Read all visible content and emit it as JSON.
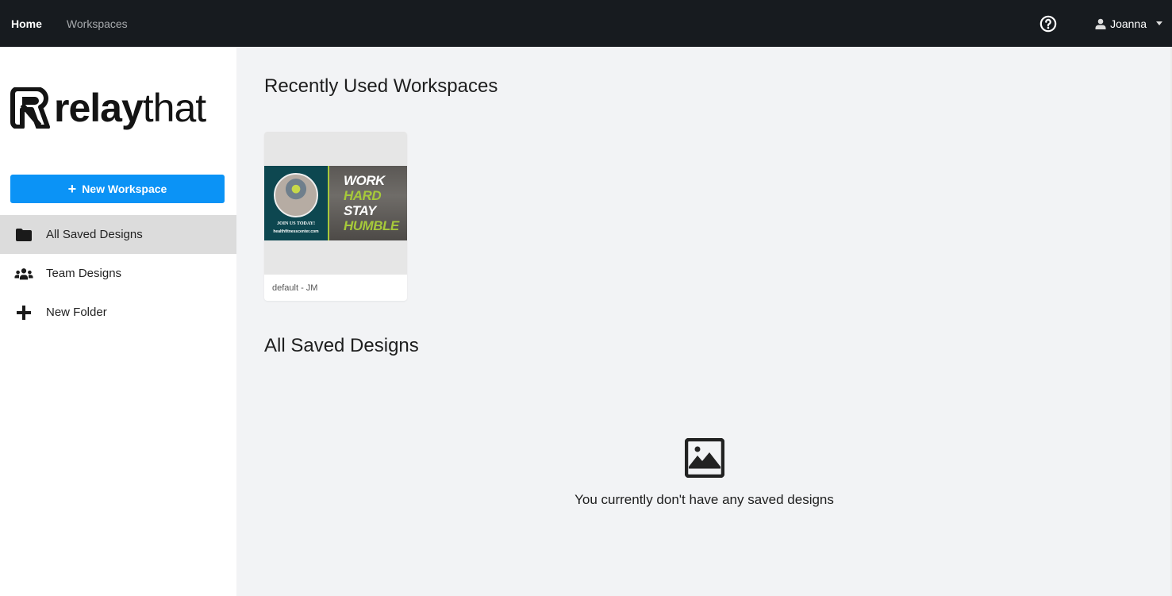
{
  "topbar": {
    "nav": [
      {
        "label": "Home",
        "active": true
      },
      {
        "label": "Workspaces",
        "active": false
      }
    ],
    "help_icon": "question-circle-icon",
    "user": {
      "name": "Joanna",
      "icon": "user-icon"
    }
  },
  "sidebar": {
    "logo": {
      "bold": "relay",
      "light": "that"
    },
    "new_workspace_label": "New Workspace",
    "items": [
      {
        "label": "All Saved Designs",
        "icon": "folder-icon",
        "active": true
      },
      {
        "label": "Team Designs",
        "icon": "users-icon",
        "active": false
      },
      {
        "label": "New Folder",
        "icon": "plus-icon",
        "active": false
      }
    ]
  },
  "main": {
    "recent_title": "Recently Used Workspaces",
    "workspaces": [
      {
        "label": "default - JM",
        "thumbnail": {
          "cta": "JOIN US TODAY!",
          "url": "healthfitnesscenter.com",
          "headline": [
            "WORK",
            "HARD",
            "STAY",
            "HUMBLE"
          ]
        }
      }
    ],
    "saved_title": "All Saved Designs",
    "empty_message": "You currently don't have any saved designs"
  },
  "colors": {
    "topbar_bg": "#171b1f",
    "primary_button": "#0b93f6",
    "accent_green": "#a6c93a",
    "thumb_teal": "#0d4750"
  }
}
